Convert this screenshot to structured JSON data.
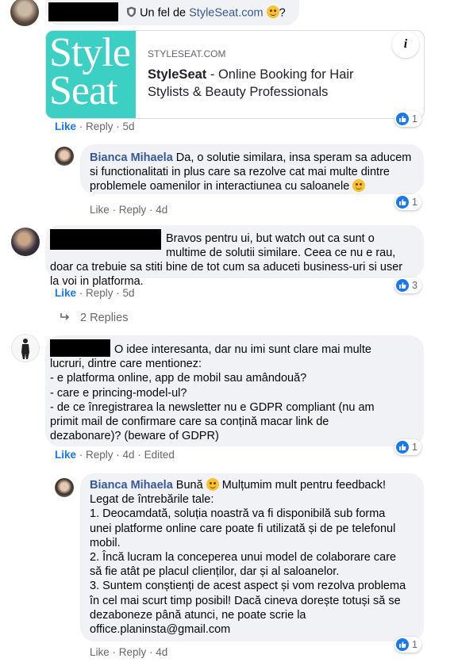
{
  "post": {
    "prefix": "Un fel de ",
    "link_text": "StyleSeat.com",
    "suffix": " ?",
    "preview": {
      "logo_line1": "Style",
      "logo_line2": "Seat",
      "domain": "STYLESEAT.COM",
      "title_brand": "StyleSeat",
      "title_rest": " - Online Booking for Hair Stylists & Beauty Professionals",
      "info_icon": "i"
    },
    "like": "Like",
    "reply": "Reply",
    "time": "5d",
    "reactions": "1"
  },
  "reply1": {
    "author": "Bianca Mihaela",
    "text": " Da, o solutie similara, insa speram sa aducem si functionalitati in plus care sa rezolve cat mai multe dintre problemele oamenilor in interactiunea cu saloanele ",
    "like": "Like",
    "reply": "Reply",
    "time": "4d",
    "reactions": "1"
  },
  "comment2": {
    "text": "Bravos pentru ui, but watch out ca sunt o multime de solutii similare. Ceea ce nu e rau, doar ca trebuie sa stiti bine de tot cum sa aduceti business-uri si user la voi in platforma.",
    "like": "Like",
    "reply": "Reply",
    "time": "5d",
    "reactions": "3",
    "replies_link": "2 Replies"
  },
  "comment3": {
    "line0": "O idee interesanta, dar nu imi sunt clare mai multe",
    "lines": [
      "lucruri, dintre care mentionez:",
      "- e platforma online, app de mobil sau amândouă?",
      "- care e princing-model-ul?",
      "- de ce înregistrarea la newsletter nu e GDPR compliant (nu am",
      "primit mail de confirmare care sa conțină macar link de",
      "dezabonare)? (beware of GDPR)"
    ],
    "like": "Like",
    "reply": "Reply",
    "time": "4d",
    "edited": "Edited",
    "reactions": "1"
  },
  "reply3": {
    "author": "Bianca Mihaela",
    "first_a": " Bună ",
    "first_b": " Mulțumim mult pentru feedback!",
    "lines": [
      "Legat de întrebările tale:",
      "1. Deocamdată, soluția noastră va fi disponibilă sub forma",
      "unei platforme online care poate fi utilizată și de pe telefonul",
      "mobil.",
      "2. Încă lucram la conceperea unui model de colaborare care",
      "să fie atât pe placul clienților, dar și al saloanelor.",
      "3. Suntem conștienți de acest aspect și vom rezolva problema",
      "în cel mai scurt timp posibil! Dacă cineva dorește totuși să se",
      "dezaboneze până atunci, ne poate scrie la",
      "office.planinsta@gmail.com"
    ],
    "like": "Like",
    "reply": "Reply",
    "time": "4d",
    "reactions": "1"
  },
  "icons": {
    "thumb": "like-thumb-icon",
    "reply_arrow": "reply-arrow-icon",
    "smiley": "smiling-emoji-icon",
    "shield": "shield-badge-icon"
  },
  "colors": {
    "link_blue": "#385898",
    "like_blue": "#1877f2",
    "bubble_bg": "#f0f2f5",
    "meta_grey": "#65676b",
    "styleseat_teal": "#3ccfc4"
  }
}
